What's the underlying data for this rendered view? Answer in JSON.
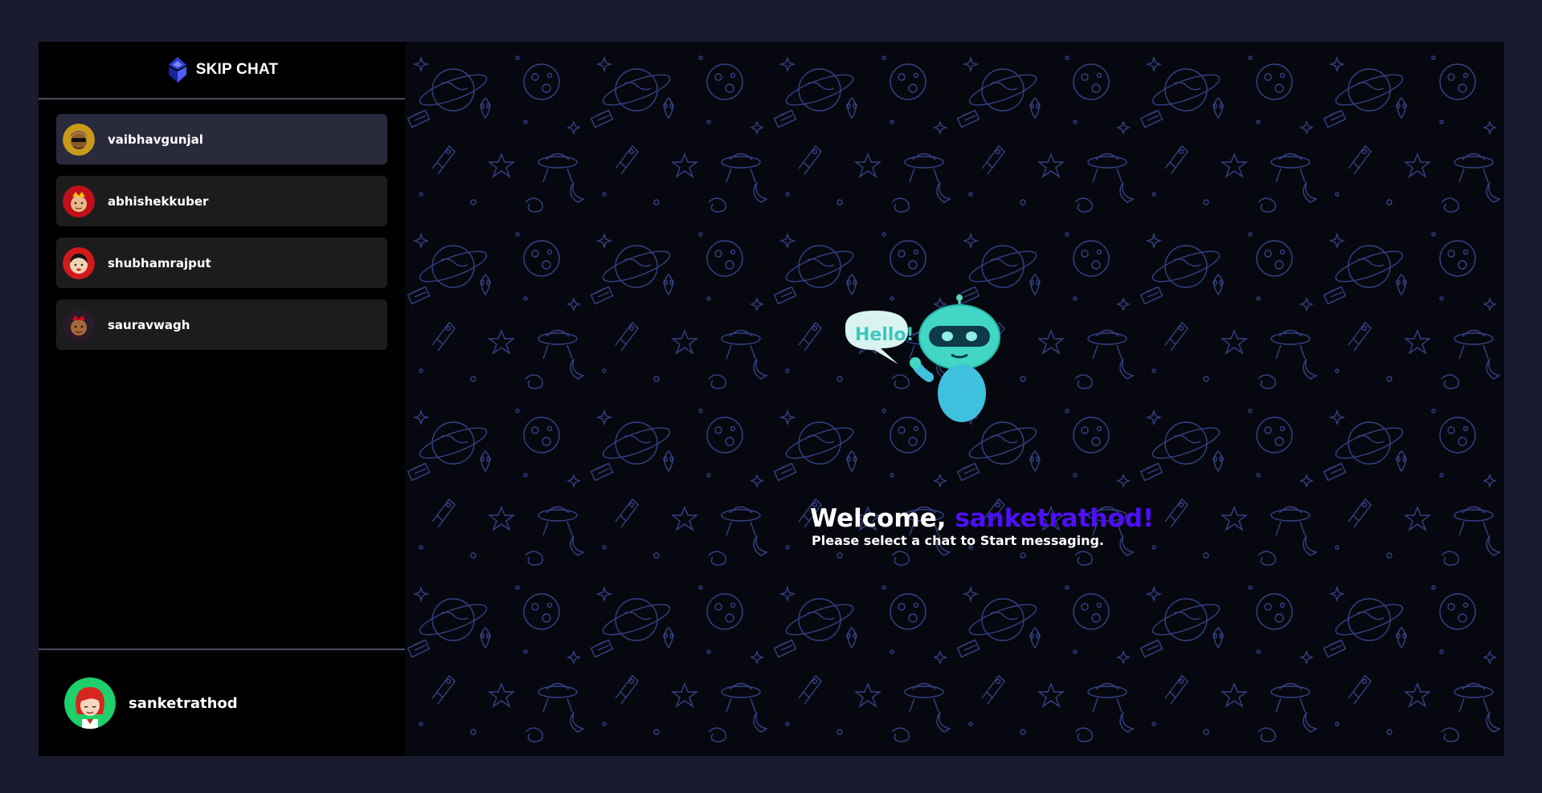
{
  "app": {
    "title": "SKIP CHAT",
    "brand_color": "#4e0eff"
  },
  "contacts": [
    {
      "name": "vaibhavgunjal",
      "avatar": "avatar-yellow-sunglasses",
      "active": true
    },
    {
      "name": "abhishekkuber",
      "avatar": "avatar-red-crown",
      "active": false
    },
    {
      "name": "shubhamrajput",
      "avatar": "avatar-red-face",
      "active": false
    },
    {
      "name": "sauravwagh",
      "avatar": "avatar-dark-face",
      "active": false
    }
  ],
  "current_user": {
    "name": "sanketrathod",
    "avatar": "avatar-green-redhair"
  },
  "welcome": {
    "greeting": "Welcome, ",
    "username": "sanketrathod!",
    "subtitle": "Please select a chat to Start messaging.",
    "robot_bubble": "Hello!"
  },
  "colors": {
    "page_bg": "#1a1b2e",
    "sidebar_bg": "#000000",
    "contact_bg": "#1c1c1c",
    "contact_active_bg": "#2a2a3d",
    "accent": "#4e0eff",
    "doodle_stroke": "#3a4a9a"
  }
}
